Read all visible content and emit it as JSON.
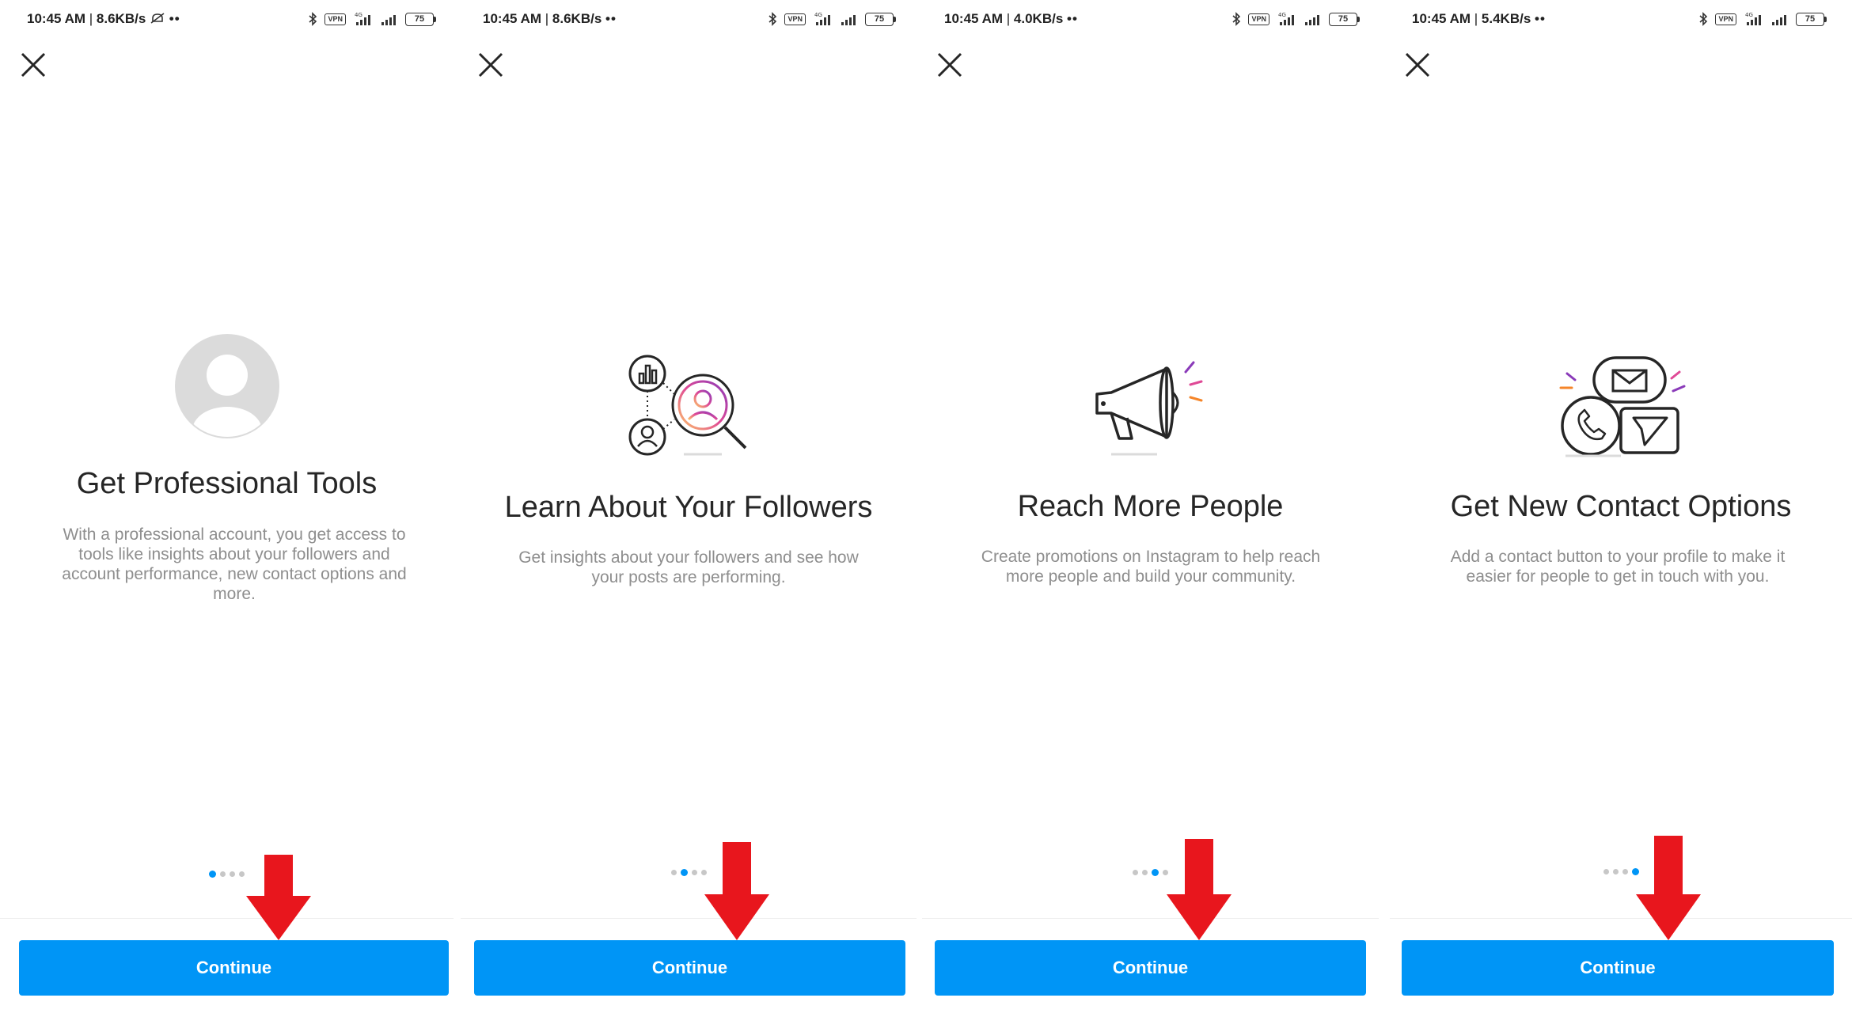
{
  "panels": [
    {
      "status": {
        "time": "10:45 AM",
        "separator": "|",
        "speed": "8.6KB/s",
        "dots": "••",
        "vpn": "VPN",
        "battery": "75",
        "net": "4G"
      },
      "hero_icon": "default-avatar-icon",
      "title": "Get Professional Tools",
      "description": "With a professional account, you get access to tools like insights about your followers and account performance, new contact options and more.",
      "active_dot": 0,
      "continue_label": "Continue"
    },
    {
      "status": {
        "time": "10:45 AM",
        "separator": "|",
        "speed": "8.6KB/s",
        "dots": "••",
        "vpn": "VPN",
        "battery": "75",
        "net": "4G"
      },
      "hero_icon": "followers-insights-icon",
      "title": "Learn About Your Followers",
      "description": "Get insights about your followers and see how your posts are performing.",
      "active_dot": 1,
      "continue_label": "Continue"
    },
    {
      "status": {
        "time": "10:45 AM",
        "separator": "|",
        "speed": "4.0KB/s",
        "dots": "••",
        "vpn": "VPN",
        "battery": "75",
        "net": "4G"
      },
      "hero_icon": "megaphone-icon",
      "title": "Reach More People",
      "description": "Create promotions on Instagram to help reach more people and build your community.",
      "active_dot": 2,
      "continue_label": "Continue"
    },
    {
      "status": {
        "time": "10:45 AM",
        "separator": "|",
        "speed": "5.4KB/s",
        "dots": "••",
        "vpn": "VPN",
        "battery": "75",
        "net": "4G"
      },
      "hero_icon": "contact-options-icon",
      "title": "Get New Contact Options",
      "description": "Add a contact button to your profile to make it easier for people to get in touch with you.",
      "active_dot": 3,
      "continue_label": "Continue"
    }
  ],
  "colors": {
    "accent": "#0095f6",
    "annotation_arrow": "#e8161d",
    "text": "#262626",
    "muted": "#8e8e8e"
  }
}
